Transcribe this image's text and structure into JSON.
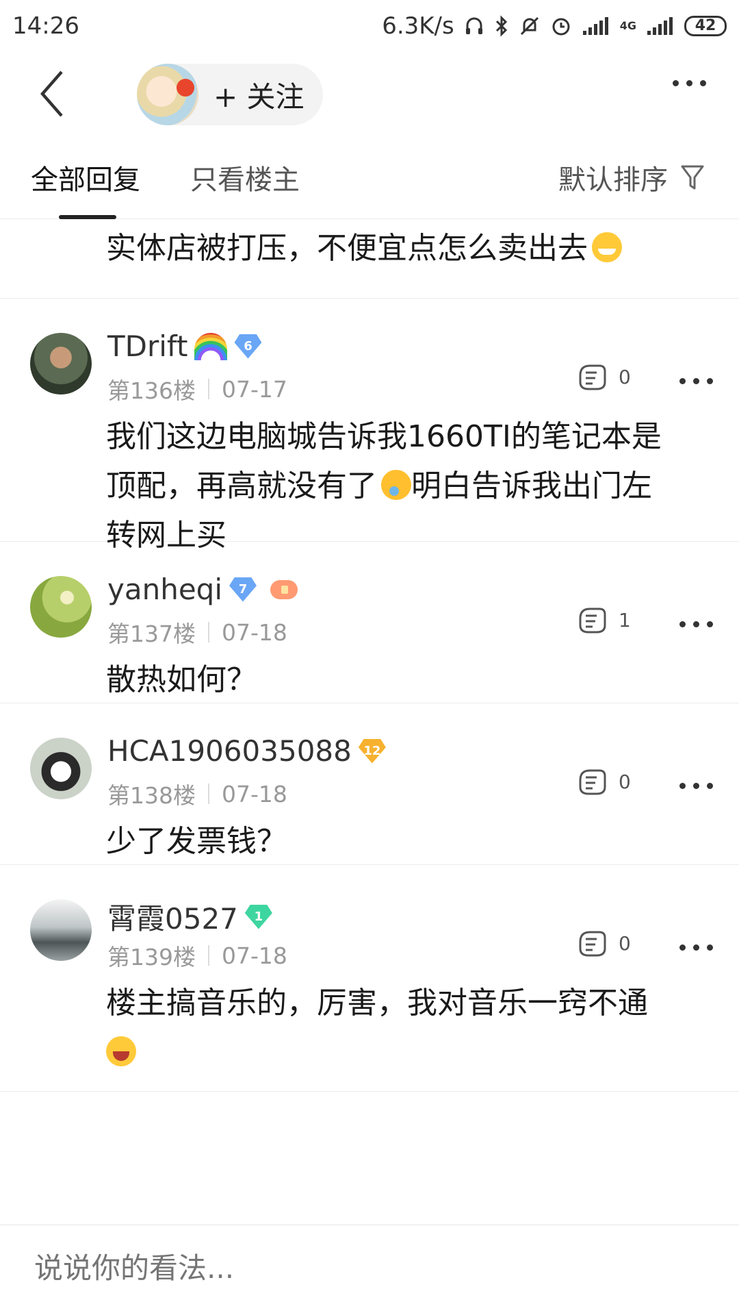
{
  "status_bar": {
    "time": "14:26",
    "network_speed": "6.3K/s",
    "network_type": "4G",
    "battery": "42"
  },
  "header": {
    "follow_label": "+ 关注"
  },
  "tabs": {
    "all_replies": "全部回复",
    "owner_only": "只看楼主",
    "sort_label": "默认排序"
  },
  "partial_post": {
    "text": "实体店被打压，不便宜点怎么卖出去"
  },
  "posts": [
    {
      "username": "TDrift",
      "level": "6",
      "floor": "第136楼",
      "date": "07-17",
      "likes": "0",
      "content_lines": [
        "我们这边电脑城告诉我1660TI的笔记本是",
        "顶配，再高就没有了",
        "明白告诉我出门左",
        "转网上买"
      ]
    },
    {
      "username": "yanheqi",
      "level": "7",
      "floor": "第137楼",
      "date": "07-18",
      "likes": "1",
      "content": "散热如何？"
    },
    {
      "username": "HCA1906035088",
      "level": "12",
      "floor": "第138楼",
      "date": "07-18",
      "likes": "0",
      "content": "少了发票钱？"
    },
    {
      "username": "霄霞0527",
      "level": "1",
      "floor": "第139楼",
      "date": "07-18",
      "likes": "0",
      "content": "楼主搞音乐的，厉害，我对音乐一窍不通"
    }
  ],
  "comment_bar": {
    "placeholder": "说说你的看法..."
  },
  "colors": {
    "badge_blue": "#6aa6f6",
    "badge_gold": "#f7b12f",
    "badge_green": "#3ed6a0",
    "meta_gray": "#999999"
  },
  "icons": [
    "back-arrow-icon",
    "more-dots-icon",
    "filter-funnel-icon",
    "like-hand-icon",
    "headphones-icon",
    "bluetooth-icon",
    "mute-bell-icon",
    "alarm-icon",
    "signal-icon"
  ]
}
